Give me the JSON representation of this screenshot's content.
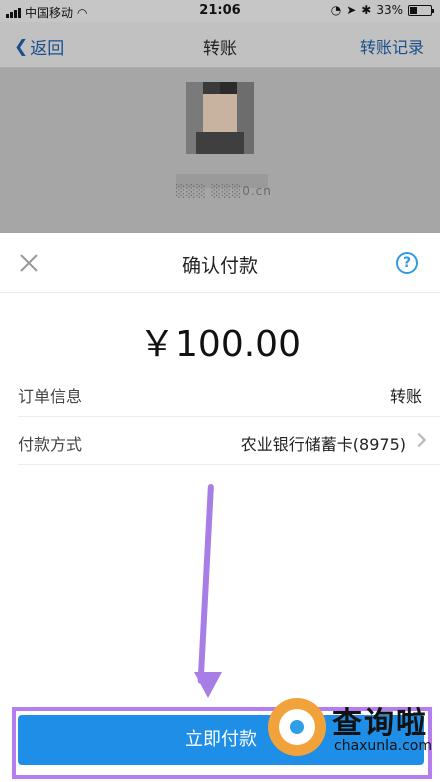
{
  "status_bar": {
    "carrier": "中国移动",
    "time": "21:06",
    "battery": "33%",
    "battery_level": 0.33
  },
  "nav": {
    "back_label": "返回",
    "title": "转账",
    "right_label": "转账记录"
  },
  "background": {
    "account_partial": "0.cn"
  },
  "sheet": {
    "title": "确认付款",
    "help_symbol": "?",
    "amount": "￥100.00",
    "rows": [
      {
        "label": "订单信息",
        "value": "转账"
      },
      {
        "label": "付款方式",
        "value": "农业银行储蓄卡(8975)"
      }
    ],
    "pay_button": "立即付款"
  },
  "watermark": {
    "title": "查询啦",
    "subtitle": "chaxunla.com"
  },
  "colors": {
    "accent": "#1f8ee6",
    "annotation": "#a77ee6",
    "help_icon": "#2f9be4"
  }
}
